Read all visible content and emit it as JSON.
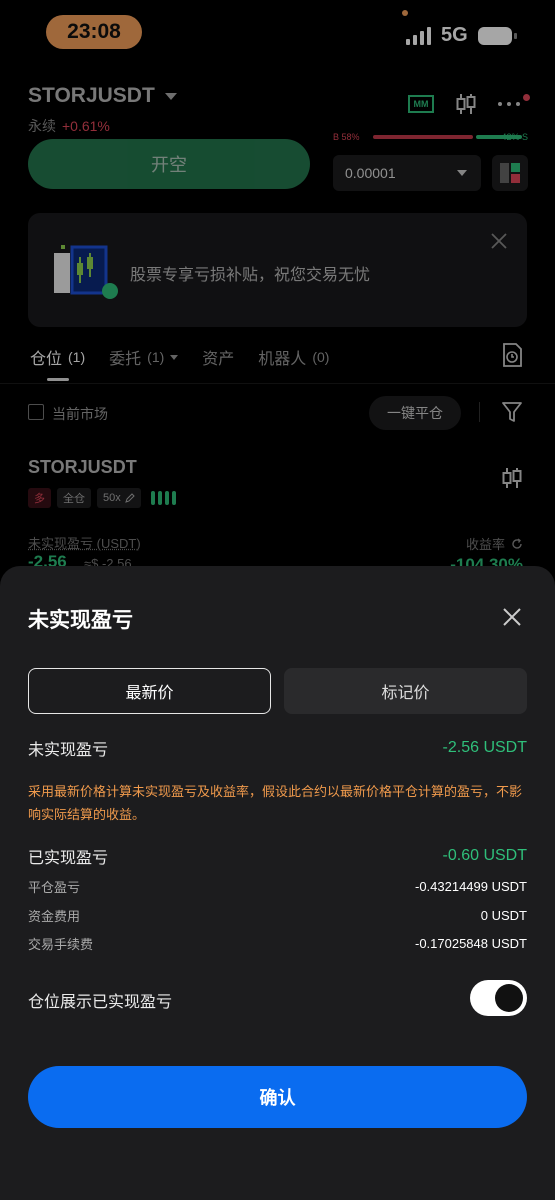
{
  "status_bar": {
    "time": "23:08",
    "network": "5G"
  },
  "header": {
    "symbol": "STORJUSDT",
    "contract_type": "永续",
    "change_pct": "+0.61%",
    "open_short_label": "开空",
    "ratio": {
      "buy_label": "B 58%",
      "sell_label": "42% S",
      "buy_fraction": 0.58
    },
    "precision": "0.00001",
    "mm_label": "MM"
  },
  "banner": {
    "text": "股票专享亏损补贴，祝您交易无忧"
  },
  "tabs": [
    {
      "label": "仓位",
      "count": "(1)"
    },
    {
      "label": "委托",
      "count": "(1)"
    },
    {
      "label": "资产",
      "count": ""
    },
    {
      "label": "机器人",
      "count": "(0)"
    }
  ],
  "filter": {
    "current_market_label": "当前市场",
    "close_all_label": "一键平仓"
  },
  "position": {
    "symbol": "STORJUSDT",
    "side_tag": "多",
    "margin_tag": "全仓",
    "leverage_tag": "50x",
    "pnl_label": "未实现盈亏 (USDT)",
    "pnl_value": "-2.56",
    "pnl_usd": "≈$ -2.56",
    "yield_label": "收益率",
    "yield_value": "-104.30%"
  },
  "sheet": {
    "title": "未实现盈亏",
    "seg_latest": "最新价",
    "seg_mark": "标记价",
    "unrealized_label": "未实现盈亏",
    "unrealized_value": "-2.56 USDT",
    "note": "采用最新价格计算未实现盈亏及收益率，假设此合约以最新价格平仓计算的盈亏，不影响实际结算的收益。",
    "realized_label": "已实现盈亏",
    "realized_value": "-0.60 USDT",
    "details": [
      {
        "label": "平仓盈亏",
        "value": "-0.43214499 USDT"
      },
      {
        "label": "资金费用",
        "value": "0 USDT"
      },
      {
        "label": "交易手续费",
        "value": "-0.17025848 USDT"
      }
    ],
    "toggle_label": "仓位展示已实现盈亏",
    "toggle_on": true,
    "confirm_label": "确认"
  },
  "colors": {
    "green": "#2fbf7a",
    "red": "#e0485a",
    "blue": "#0a6cf0",
    "orange": "#f09a4c"
  }
}
